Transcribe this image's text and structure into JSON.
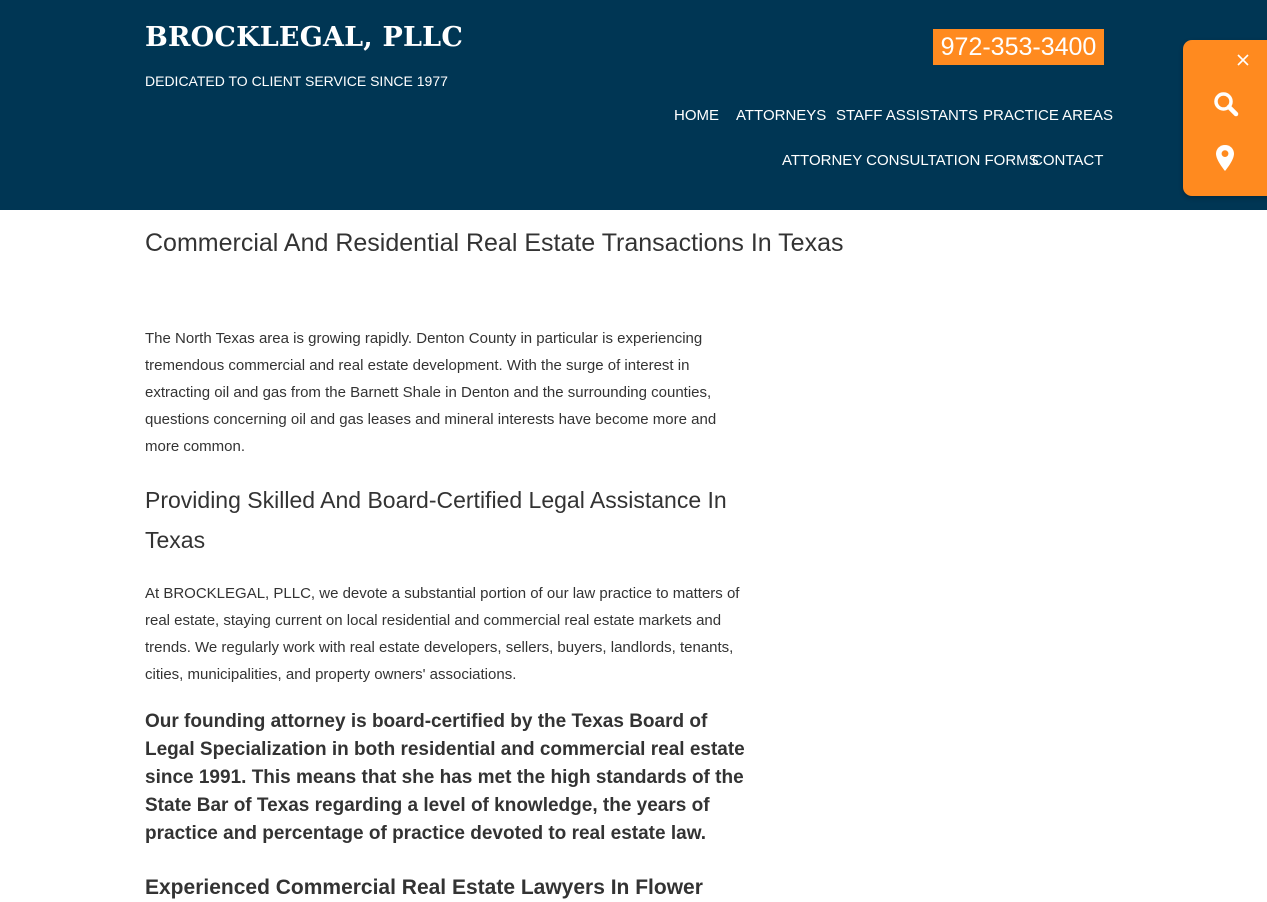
{
  "header": {
    "title": "BROCKLEGAL, PLLC",
    "tagline": "DEDICATED TO CLIENT SERVICE SINCE 1977",
    "phone": "972-353-3400",
    "background_color": "#003654",
    "accent_color": "#ff8a1f"
  },
  "nav": {
    "home": "HOME",
    "attorneys": "ATTORNEYS",
    "staff_assistants": "STAFF ASSISTANTS",
    "practice_areas": "PRACTICE AREAS",
    "consultation_forms": "ATTORNEY CONSULTATION FORMS",
    "contact": "CONTACT"
  },
  "side_widget": {
    "icons": [
      "close-icon",
      "search-icon",
      "map-pin-icon"
    ]
  },
  "main": {
    "title": "Commercial And Residential Real Estate Transactions In Texas",
    "para1": "The North Texas area is growing rapidly. Denton County in particular is experiencing tremendous commercial and real estate development. With the surge of interest in extracting oil and gas from the Barnett Shale in Denton and the surrounding counties, questions concerning oil and gas leases and mineral interests have become more and more common.",
    "heading2": "Providing Skilled And Board-Certified Legal Assistance In Texas",
    "para2": "At BROCKLEGAL, PLLC, we devote a substantial portion of our law practice to matters of real estate, staying current on local residential and commercial real estate markets and trends. We regularly work with real estate developers, sellers, buyers, landlords, tenants, cities, municipalities, and property owners' associations.",
    "bold_para": "Our founding attorney is board-certified by the Texas Board of Legal Specialization in both residential and commercial real estate since 1991. This means that she has met the high standards of the State Bar of Texas regarding a level of knowledge, the years of practice and percentage of practice devoted to real estate law.",
    "heading3": "Experienced Commercial Real Estate Lawyers In Flower"
  }
}
